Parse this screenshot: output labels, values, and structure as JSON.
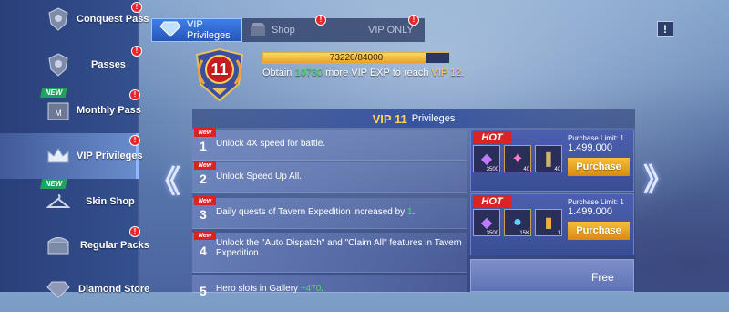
{
  "sidebar": {
    "items": [
      {
        "label": "Conquest Pass",
        "icon": "helmet-icon"
      },
      {
        "label": "Passes",
        "icon": "helmet-icon"
      },
      {
        "label": "Monthly Pass",
        "icon": "calendar-icon",
        "tag": "NEW"
      },
      {
        "label": "VIP Privileges",
        "icon": "crown-icon"
      },
      {
        "label": "Skin Shop",
        "icon": "hanger-icon",
        "tag": "NEW"
      },
      {
        "label": "Regular Packs",
        "icon": "chest-icon"
      },
      {
        "label": "Diamond Store",
        "icon": "diamond-icon"
      }
    ]
  },
  "tabs": [
    {
      "label": "VIP Privileges",
      "active": true
    },
    {
      "label": "Shop",
      "active": false
    },
    {
      "label": "VIP ONLY",
      "active": false
    }
  ],
  "info_label": "!",
  "vip": {
    "level": "11",
    "progress_text": "73220/84000",
    "progress_fraction": 0.872,
    "obtain_prefix": "Obtain",
    "obtain_amount": "10780",
    "obtain_middle": "more VIP EXP to reach",
    "obtain_target": "VIP 12."
  },
  "panel": {
    "title_vip": "VIP 11",
    "title_rest": "Privileges"
  },
  "privileges": [
    {
      "num": "1",
      "new": "New",
      "text": "Unlock 4X speed for battle."
    },
    {
      "num": "2",
      "new": "New",
      "text": "Unlock Speed Up All."
    },
    {
      "num": "3",
      "new": "New",
      "text_a": "Daily quests of Tavern Expedition increased by",
      "text_b": "1",
      "text_c": "."
    },
    {
      "num": "4",
      "new": "New",
      "text": "Unlock the \"Auto Dispatch\" and \"Claim All\" features in Tavern Expedition."
    },
    {
      "num": "5",
      "text_a": "Hero slots in Gallery",
      "text_b": "+470",
      "text_c": "."
    }
  ],
  "offers": [
    {
      "hot": "HOT",
      "limit": "Purchase Limit: 1",
      "price": "1.499.000",
      "button": "Purchase",
      "items": [
        {
          "q": "3500"
        },
        {
          "q": "40"
        },
        {
          "q": "40"
        }
      ]
    },
    {
      "hot": "HOT",
      "limit": "Purchase Limit: 1",
      "price": "1.499.000",
      "button": "Purchase",
      "items": [
        {
          "q": "3500"
        },
        {
          "q": "15K"
        },
        {
          "q": "1"
        }
      ]
    }
  ],
  "free_offer": {
    "label": "Free"
  },
  "nav": {
    "prev": "《",
    "next": "》"
  },
  "colors": {
    "accent_gold": "#ffd35a",
    "green": "#4cdc6c",
    "hot_red": "#d92424"
  }
}
